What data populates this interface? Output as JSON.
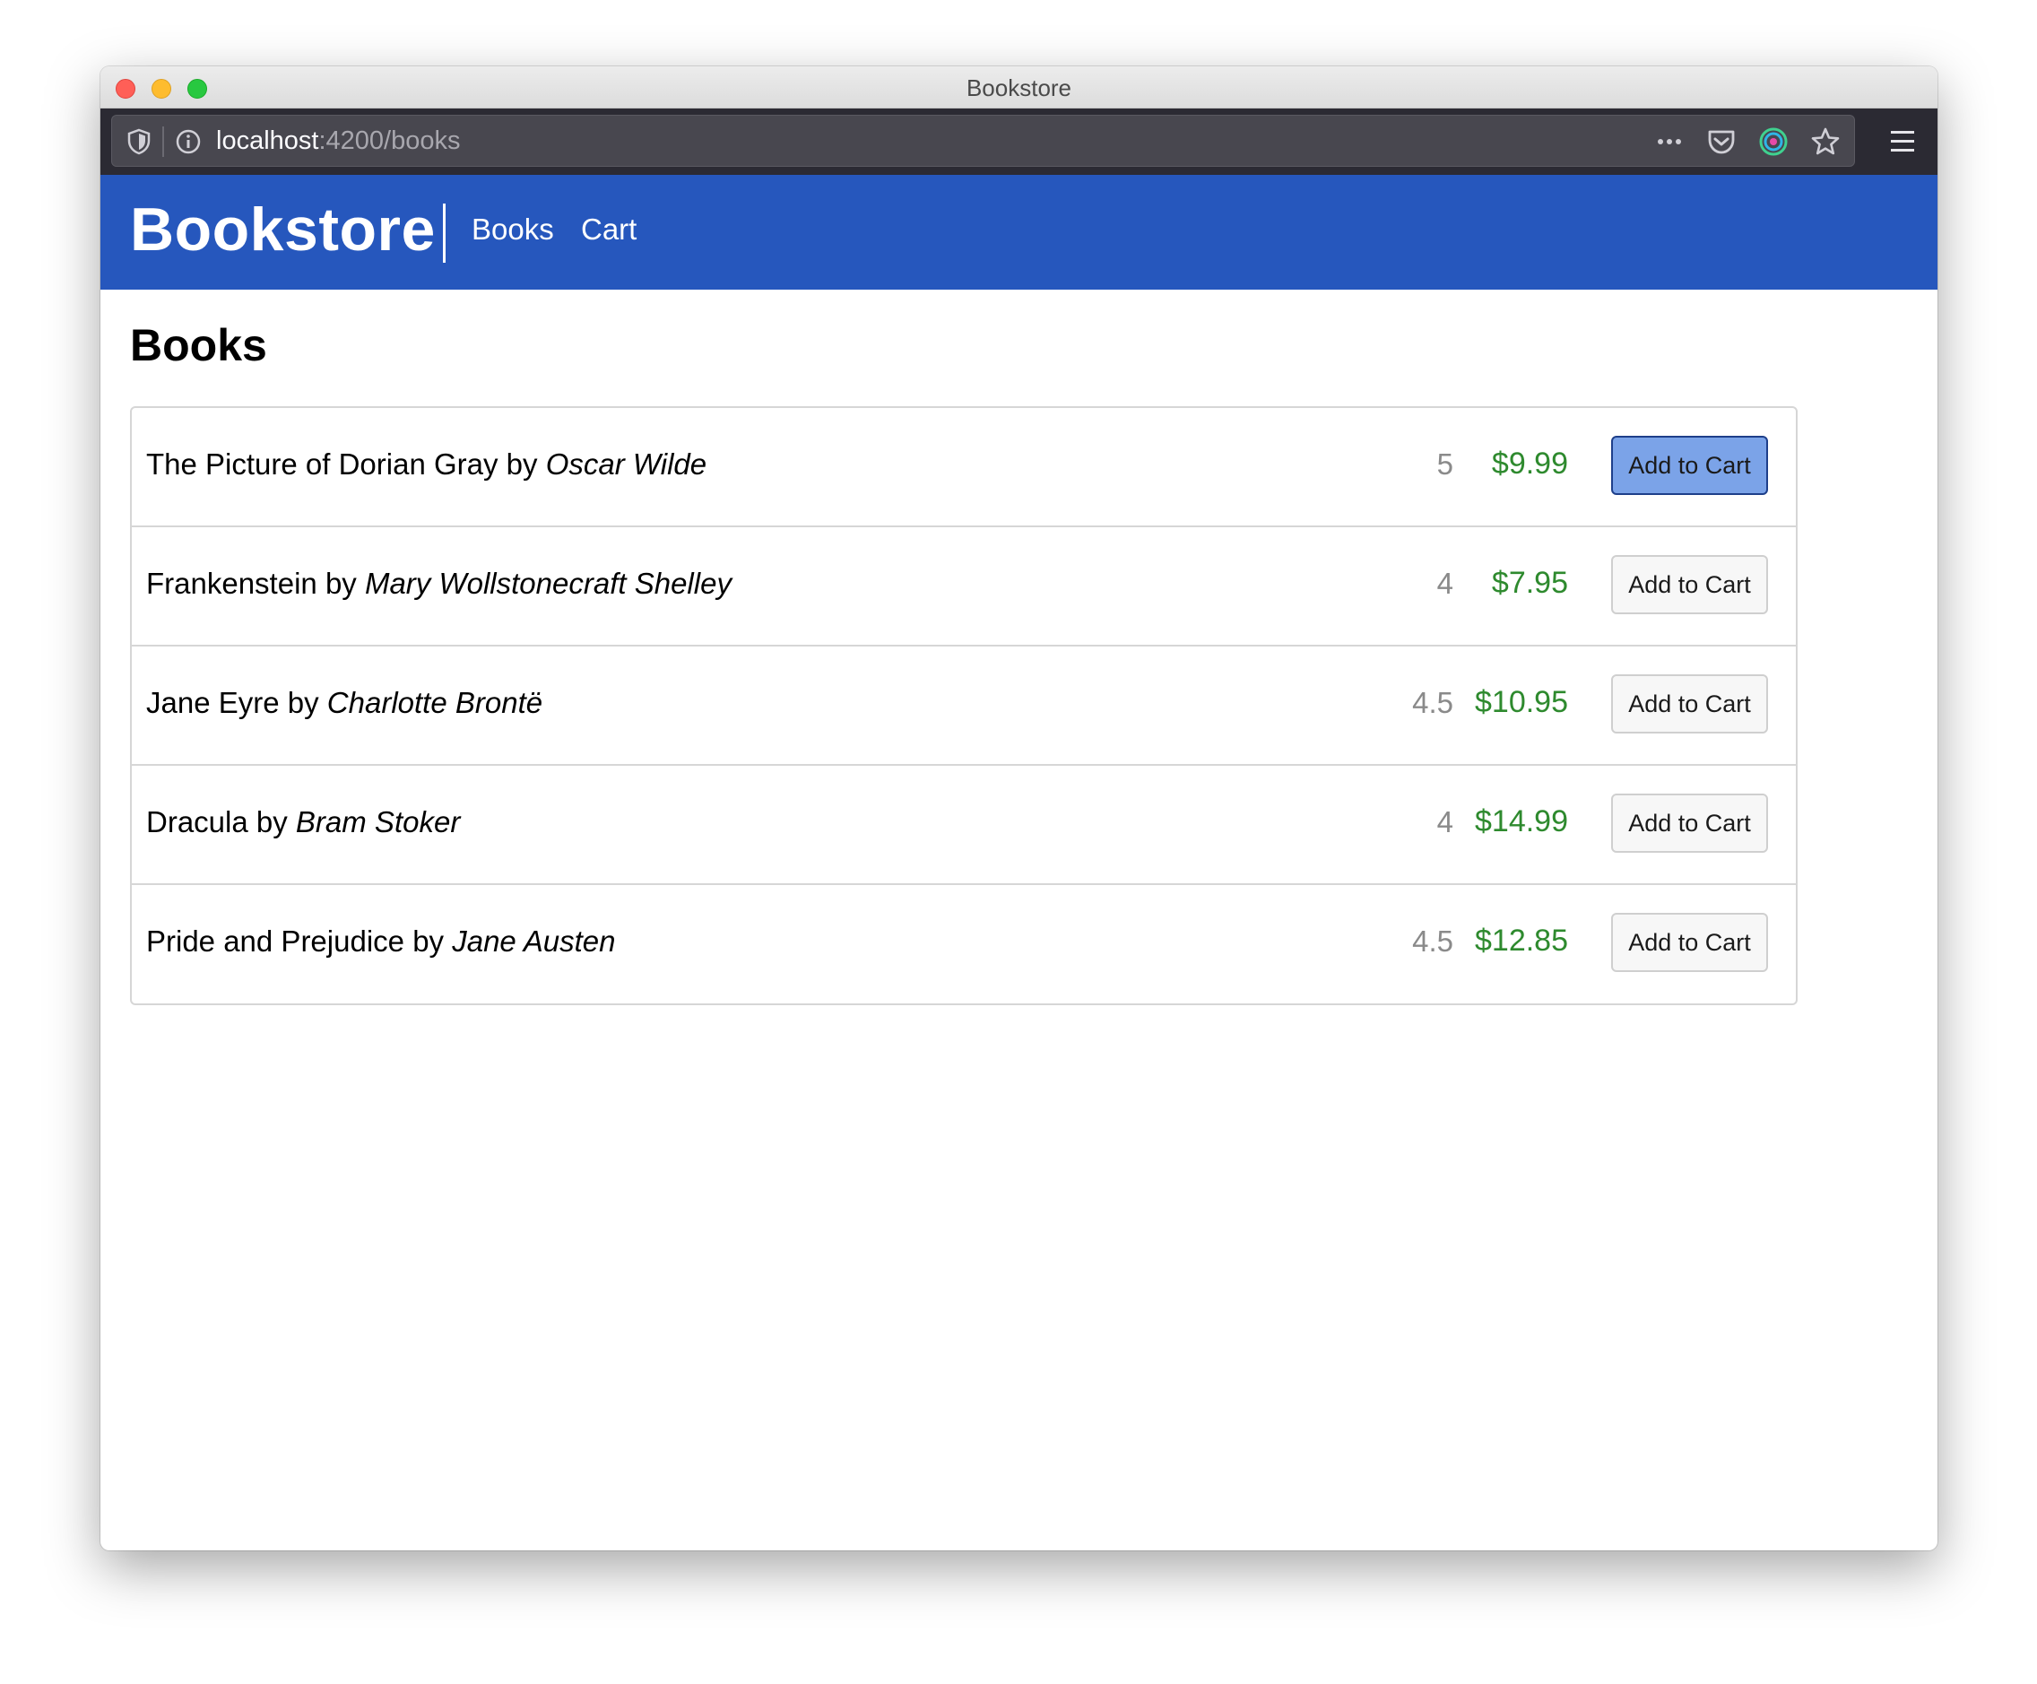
{
  "window": {
    "title": "Bookstore"
  },
  "browser": {
    "url_host": "localhost",
    "url_rest": ":4200/books",
    "icons": [
      "shield-icon",
      "info-icon",
      "more-icon",
      "pocket-icon",
      "extension-icon",
      "star-icon",
      "hamburger-menu-icon"
    ]
  },
  "navbar": {
    "brand": "Bookstore",
    "links": [
      {
        "label": "Books"
      },
      {
        "label": "Cart"
      }
    ],
    "background_color": "#2657bd"
  },
  "page": {
    "heading": "Books"
  },
  "books": [
    {
      "title": "The Picture of Dorian Gray",
      "by": "by",
      "author": "Oscar Wilde",
      "rating": "5",
      "price": "$9.99",
      "button_label": "Add to Cart",
      "button_focused": true
    },
    {
      "title": "Frankenstein",
      "by": "by",
      "author": "Mary Wollstonecraft Shelley",
      "rating": "4",
      "price": "$7.95",
      "button_label": "Add to Cart",
      "button_focused": false
    },
    {
      "title": "Jane Eyre",
      "by": "by",
      "author": "Charlotte Brontë",
      "rating": "4.5",
      "price": "$10.95",
      "button_label": "Add to Cart",
      "button_focused": false
    },
    {
      "title": "Dracula",
      "by": "by",
      "author": "Bram Stoker",
      "rating": "4",
      "price": "$14.99",
      "button_label": "Add to Cart",
      "button_focused": false
    },
    {
      "title": "Pride and Prejudice",
      "by": "by",
      "author": "Jane Austen",
      "rating": "4.5",
      "price": "$12.85",
      "button_label": "Add to Cart",
      "button_focused": false
    }
  ],
  "colors": {
    "price": "#2e8a2e",
    "rating": "#8a8a8a",
    "focused_button": "#7ba3e8"
  }
}
